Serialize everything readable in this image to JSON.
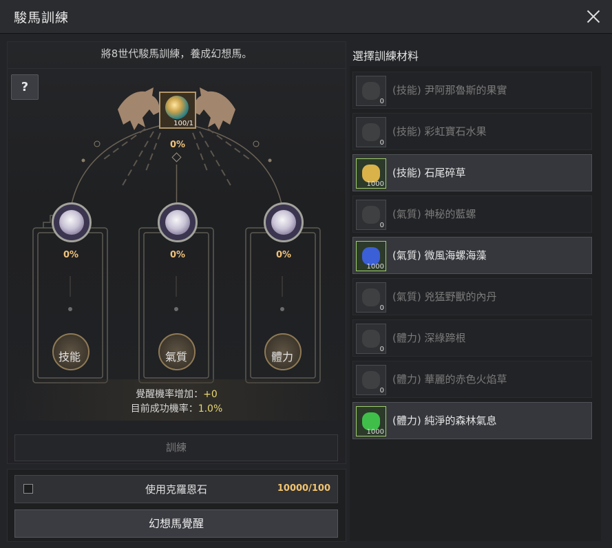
{
  "window": {
    "title": "駿馬訓練"
  },
  "left": {
    "subtitle": "將8世代駿馬訓練，養成幻想馬。",
    "help_label": "?",
    "main_icon_count": "100/1",
    "main_percent": "0%",
    "stats": [
      {
        "label": "技能",
        "percent": "0%"
      },
      {
        "label": "氣質",
        "percent": "0%"
      },
      {
        "label": "體力",
        "percent": "0%"
      }
    ],
    "info": {
      "awaken_rate_label": "覺醒機率增加：",
      "awaken_rate_value": "+0",
      "success_rate_label": "目前成功機率：",
      "success_rate_value": "1.0%"
    },
    "train_label": "訓練"
  },
  "bottom": {
    "use_stone_label": "使用克羅恩石",
    "use_stone_count": "10000/100",
    "awaken_label": "幻想馬覺醒"
  },
  "materials": {
    "title": "選擇訓練材料",
    "items": [
      {
        "name": "(技能) 尹阿那魯斯的果實",
        "count": "0",
        "active": false,
        "color": "#8a8a8a"
      },
      {
        "name": "(技能) 彩虹寶石水果",
        "count": "0",
        "active": false,
        "color": "#8a8a8a"
      },
      {
        "name": "(技能) 石尾碎草",
        "count": "1000",
        "active": true,
        "color": "#d9b24a"
      },
      {
        "name": "(氣質) 神秘的藍螺",
        "count": "0",
        "active": false,
        "color": "#8a8a8a"
      },
      {
        "name": "(氣質) 微風海螺海藻",
        "count": "1000",
        "active": true,
        "color": "#3b5fd6"
      },
      {
        "name": "(氣質) 兇猛野獸的內丹",
        "count": "0",
        "active": false,
        "color": "#8a8a8a"
      },
      {
        "name": "(體力) 深綠蹄根",
        "count": "0",
        "active": false,
        "color": "#8a8a8a"
      },
      {
        "name": "(體力) 華麗的赤色火焰草",
        "count": "0",
        "active": false,
        "color": "#8a8a8a"
      },
      {
        "name": "(體力) 純淨的森林氣息",
        "count": "1000",
        "active": true,
        "color": "#3fbf4a"
      }
    ]
  }
}
